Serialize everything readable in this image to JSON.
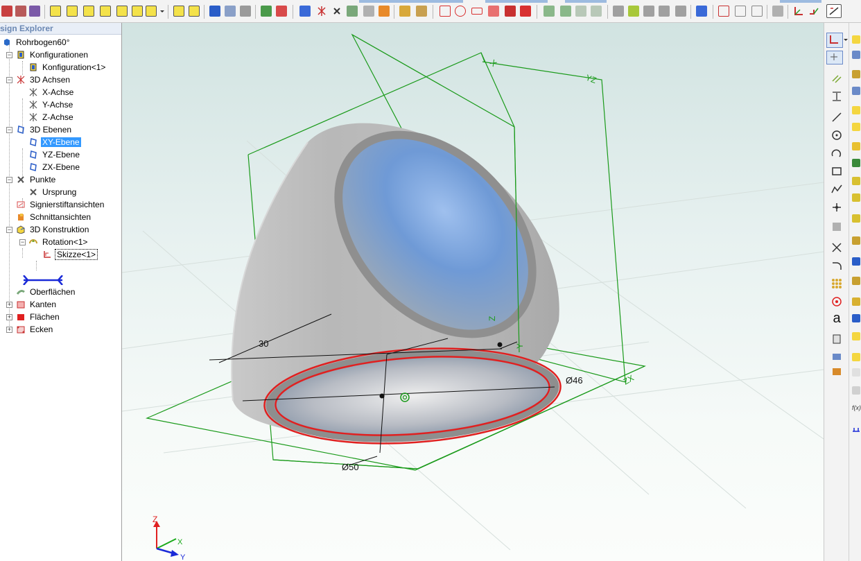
{
  "panel": {
    "title": "sign Explorer"
  },
  "tree": {
    "root": "Rohrbogen60°",
    "konfigurationen": "Konfigurationen",
    "konfiguration1": "Konfiguration<1>",
    "achsen": "3D Achsen",
    "xachse": "X-Achse",
    "yachse": "Y-Achse",
    "zachse": "Z-Achse",
    "ebenen": "3D Ebenen",
    "xy": "XY-Ebene",
    "yz": "YZ-Ebene",
    "zx": "ZX-Ebene",
    "punkte": "Punkte",
    "ursprung": "Ursprung",
    "signier": "Signierstiftansichten",
    "schnitt": "Schnittansichten",
    "konstruktion": "3D Konstruktion",
    "rotation": "Rotation<1>",
    "skizze": "Skizze<1>",
    "oberflaechen": "Oberflächen",
    "kanten": "Kanten",
    "flaechen": "Flächen",
    "ecken": "Ecken"
  },
  "viewport": {
    "plane_label_x": "X",
    "plane_label_yz": "YZ",
    "plane_label_z": "Z",
    "plane_label_y": "Y",
    "plane_label_zx": "ZX",
    "dim_30": "30",
    "dim_46": "Ø46",
    "dim_50": "Ø50",
    "triad_z": "Z",
    "triad_x": "X",
    "triad_y": "Y"
  },
  "rightbar": {
    "text_tool": "a",
    "fx_tool": "f(x)"
  },
  "colors": {
    "plane_green": "#1a9a1a",
    "sketch_red": "#e02020",
    "selection_blue": "#3399ff",
    "pipe_grey": "#c4c4c4",
    "pipe_inner_blue": "#6f9ad6"
  }
}
